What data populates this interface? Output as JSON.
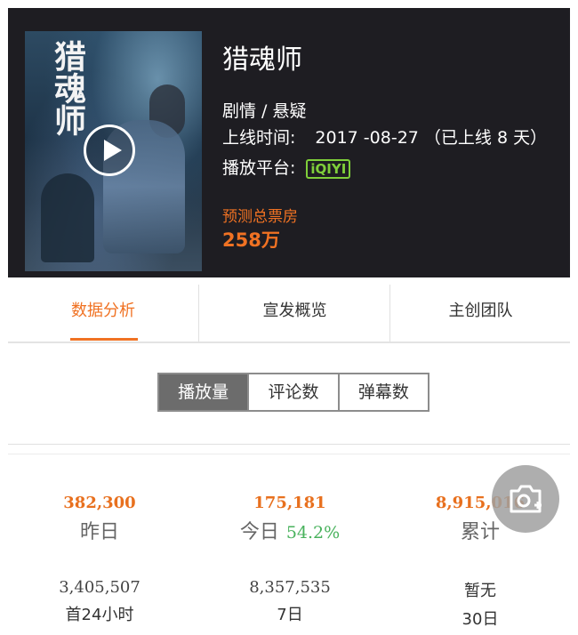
{
  "movie": {
    "poster_title": "猎魂师",
    "title": "猎魂师",
    "genre": "剧情 / 悬疑",
    "release_label": "上线时间:",
    "release_value": "2017 -08-27 （已上线 8 天）",
    "platform_label": "播放平台:",
    "platform_logo": "iQIYI",
    "predict_label": "预测总票房",
    "predict_value": "258万"
  },
  "tabs": [
    {
      "label": "数据分析",
      "active": true
    },
    {
      "label": "宣发概览",
      "active": false
    },
    {
      "label": "主创团队",
      "active": false
    }
  ],
  "segments": [
    {
      "label": "播放量",
      "active": true
    },
    {
      "label": "评论数",
      "active": false
    },
    {
      "label": "弹幕数",
      "active": false
    }
  ],
  "stats": [
    {
      "value": "382,300",
      "label": "昨日"
    },
    {
      "value": "175,181",
      "label": "今日",
      "change": "54.2%"
    },
    {
      "value": "8,915,016",
      "label": "累计"
    }
  ],
  "substats": [
    {
      "value": "3,405,507",
      "label": "首24小时"
    },
    {
      "value": "8,357,535",
      "label": "7日"
    },
    {
      "value": "暂无",
      "label": "30日"
    }
  ],
  "colors": {
    "accent": "#f07223",
    "header_bg": "#1e1d22",
    "positive": "#49b25d",
    "platform": "#7fcf3a"
  },
  "icons": {
    "play": "play-icon",
    "camera": "camera-add-icon"
  }
}
